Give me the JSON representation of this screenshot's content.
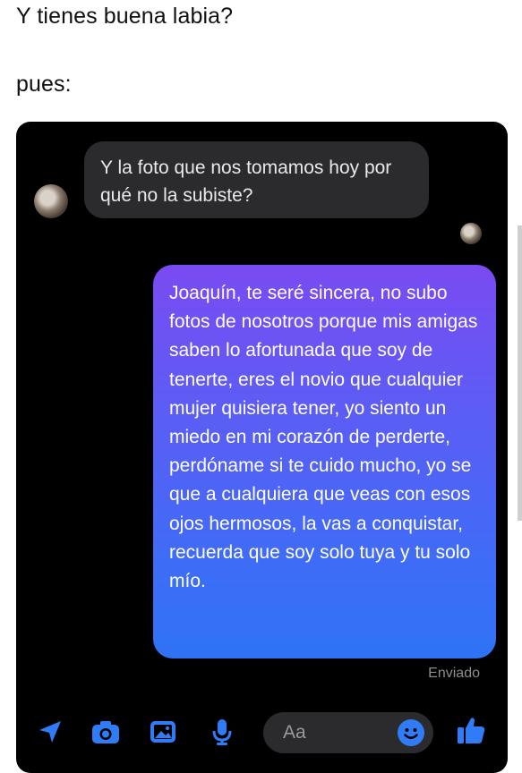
{
  "caption": {
    "line1": "Y tienes buena labia?",
    "line2": "pues:"
  },
  "chat": {
    "incoming_message": "Y la foto que nos tomamos hoy por qué no la subiste?",
    "outgoing_message": "Joaquín, te seré sincera, no subo fotos de nosotros porque mis amigas saben lo afortunada que soy de tenerte, eres el novio que cualquier mujer quisiera tener, yo siento un miedo en mi corazón de perderte, perdóname si te cuido mucho, yo se que a cualquiera que veas con esos ojos hermosos, la vas a conquistar, recuerda que soy solo tuya y tu solo mío.",
    "status": "Enviado"
  },
  "composer": {
    "placeholder": "Aa"
  },
  "icons": [
    "send-location-icon",
    "camera-icon",
    "image-icon",
    "microphone-icon",
    "emoji-icon",
    "thumbs-up-icon"
  ],
  "colors": {
    "accent": "#2f7cf6",
    "incoming_bubble": "#2b2b2e",
    "outgoing_top": "#7a4bf2",
    "outgoing_bottom": "#2f73f5"
  }
}
